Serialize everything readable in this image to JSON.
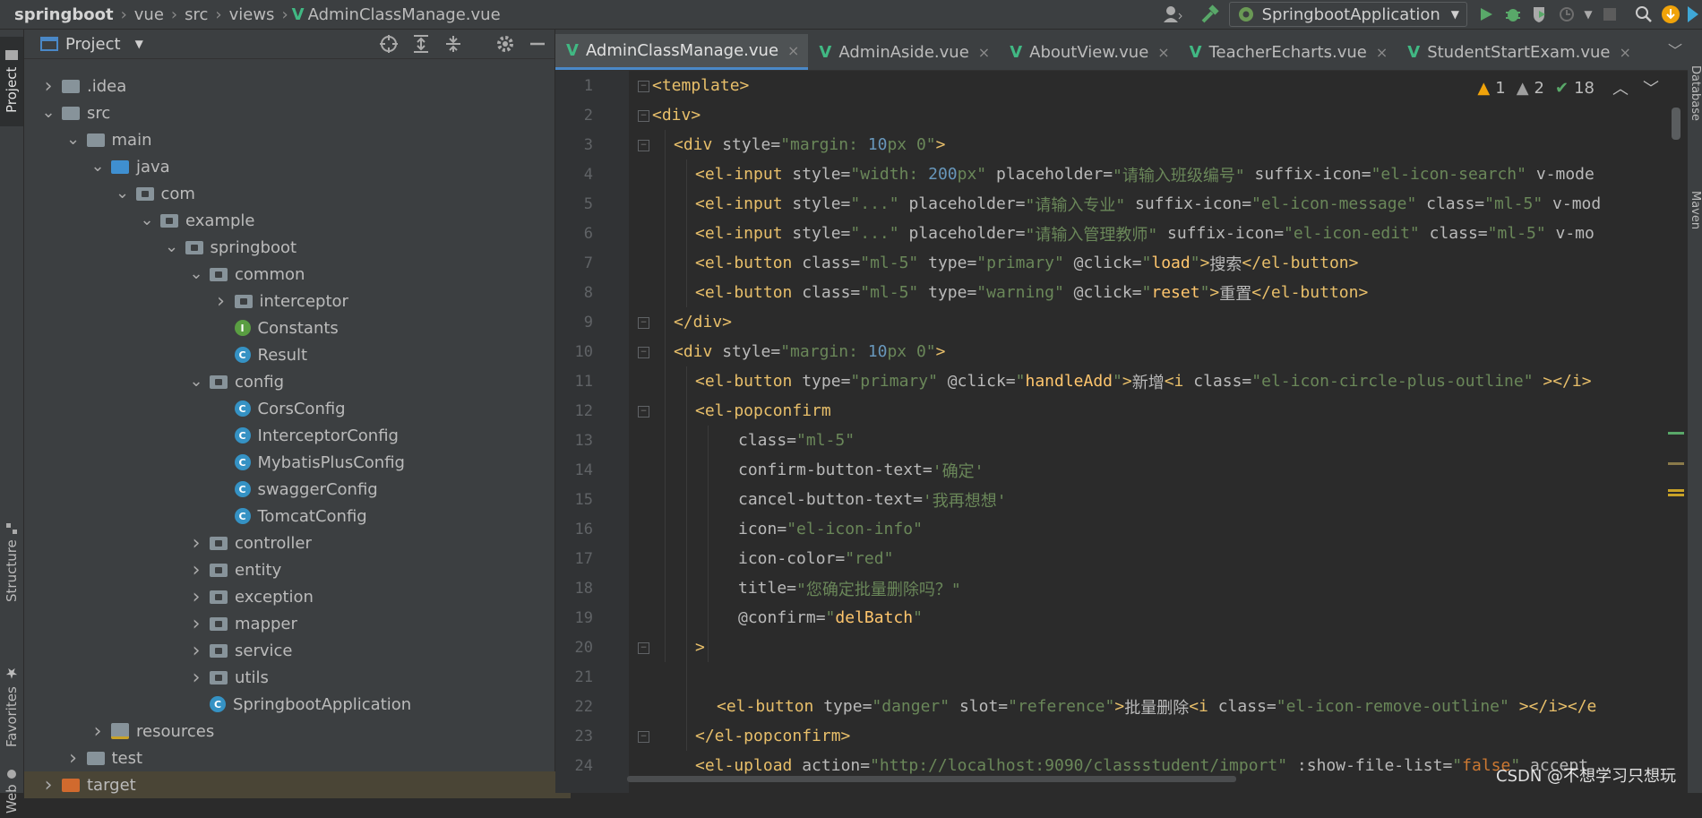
{
  "breadcrumb": [
    "springboot",
    "vue",
    "src",
    "views",
    "AdminClassManage.vue"
  ],
  "run_config": "SpringbootApplication",
  "side_tabs": {
    "project": "Project",
    "structure": "Structure",
    "favorites": "Favorites",
    "web": "Web"
  },
  "right_tabs": {
    "database": "Database",
    "maven": "Maven"
  },
  "project_panel": {
    "title": "Project"
  },
  "tree": [
    {
      "label": ".idea",
      "depth": 1,
      "chevron": "right",
      "icon": "folder"
    },
    {
      "label": "src",
      "depth": 1,
      "chevron": "down",
      "icon": "folder"
    },
    {
      "label": "main",
      "depth": 2,
      "chevron": "down",
      "icon": "folder"
    },
    {
      "label": "java",
      "depth": 3,
      "chevron": "down",
      "icon": "folder-source"
    },
    {
      "label": "com",
      "depth": 4,
      "chevron": "down",
      "icon": "package"
    },
    {
      "label": "example",
      "depth": 5,
      "chevron": "down",
      "icon": "package"
    },
    {
      "label": "springboot",
      "depth": 6,
      "chevron": "down",
      "icon": "package"
    },
    {
      "label": "common",
      "depth": 7,
      "chevron": "down",
      "icon": "package"
    },
    {
      "label": "interceptor",
      "depth": 8,
      "chevron": "right",
      "icon": "package"
    },
    {
      "label": "Constants",
      "depth": 8,
      "chevron": "",
      "icon": "interface"
    },
    {
      "label": "Result",
      "depth": 8,
      "chevron": "",
      "icon": "class"
    },
    {
      "label": "config",
      "depth": 7,
      "chevron": "down",
      "icon": "package"
    },
    {
      "label": "CorsConfig",
      "depth": 8,
      "chevron": "",
      "icon": "class"
    },
    {
      "label": "InterceptorConfig",
      "depth": 8,
      "chevron": "",
      "icon": "class"
    },
    {
      "label": "MybatisPlusConfig",
      "depth": 8,
      "chevron": "",
      "icon": "class"
    },
    {
      "label": "swaggerConfig",
      "depth": 8,
      "chevron": "",
      "icon": "class"
    },
    {
      "label": "TomcatConfig",
      "depth": 8,
      "chevron": "",
      "icon": "class"
    },
    {
      "label": "controller",
      "depth": 7,
      "chevron": "right",
      "icon": "package"
    },
    {
      "label": "entity",
      "depth": 7,
      "chevron": "right",
      "icon": "package"
    },
    {
      "label": "exception",
      "depth": 7,
      "chevron": "right",
      "icon": "package"
    },
    {
      "label": "mapper",
      "depth": 7,
      "chevron": "right",
      "icon": "package"
    },
    {
      "label": "service",
      "depth": 7,
      "chevron": "right",
      "icon": "package"
    },
    {
      "label": "utils",
      "depth": 7,
      "chevron": "right",
      "icon": "package"
    },
    {
      "label": "SpringbootApplication",
      "depth": 7,
      "chevron": "",
      "icon": "class"
    },
    {
      "label": "resources",
      "depth": 3,
      "chevron": "right",
      "icon": "folder-resources"
    },
    {
      "label": "test",
      "depth": 2,
      "chevron": "right",
      "icon": "folder"
    },
    {
      "label": "target",
      "depth": 1,
      "chevron": "right",
      "icon": "folder-excluded"
    }
  ],
  "editor_tabs": [
    "AdminClassManage.vue",
    "AdminAside.vue",
    "AboutView.vue",
    "TeacherEcharts.vue",
    "StudentStartExam.vue"
  ],
  "inspections": {
    "warnings": "1",
    "weak_warnings": "2",
    "ok": "18"
  },
  "code_lines": [
    {
      "n": "1",
      "indent": 0,
      "tokens": [
        [
          "tg",
          "<template>"
        ]
      ]
    },
    {
      "n": "2",
      "indent": 0,
      "tokens": [
        [
          "tg",
          "<div>"
        ]
      ]
    },
    {
      "n": "3",
      "indent": 1,
      "tokens": [
        [
          "tg",
          "<div "
        ],
        [
          "at",
          "style="
        ],
        [
          "sv",
          "\"margin: "
        ],
        [
          "nm",
          "10"
        ],
        [
          "sv",
          "px 0\""
        ],
        [
          "tg",
          ">"
        ]
      ]
    },
    {
      "n": "4",
      "indent": 2,
      "tokens": [
        [
          "tg",
          "<el-input "
        ],
        [
          "at",
          "style="
        ],
        [
          "sv",
          "\"width: "
        ],
        [
          "nm",
          "200"
        ],
        [
          "sv",
          "px\" "
        ],
        [
          "at",
          "placeholder="
        ],
        [
          "sv",
          "\"请输入班级编号\" "
        ],
        [
          "at",
          "suffix-icon="
        ],
        [
          "sv",
          "\"el-icon-search\" "
        ],
        [
          "at",
          "v-mode"
        ]
      ]
    },
    {
      "n": "5",
      "indent": 2,
      "tokens": [
        [
          "tg",
          "<el-input "
        ],
        [
          "at",
          "style="
        ],
        [
          "sv",
          "\"...\" "
        ],
        [
          "at",
          "placeholder="
        ],
        [
          "sv",
          "\"请输入专业\" "
        ],
        [
          "at",
          "suffix-icon="
        ],
        [
          "sv",
          "\"el-icon-message\" "
        ],
        [
          "at",
          "class="
        ],
        [
          "sv",
          "\"ml-5\" "
        ],
        [
          "at",
          "v-mod"
        ]
      ]
    },
    {
      "n": "6",
      "indent": 2,
      "tokens": [
        [
          "tg",
          "<el-input "
        ],
        [
          "at",
          "style="
        ],
        [
          "sv",
          "\"...\" "
        ],
        [
          "at",
          "placeholder="
        ],
        [
          "sv",
          "\"请输入管理教师\" "
        ],
        [
          "at",
          "suffix-icon="
        ],
        [
          "sv",
          "\"el-icon-edit\" "
        ],
        [
          "at",
          "class="
        ],
        [
          "sv",
          "\"ml-5\" "
        ],
        [
          "at",
          "v-mo"
        ]
      ]
    },
    {
      "n": "7",
      "indent": 2,
      "tokens": [
        [
          "tg",
          "<el-button "
        ],
        [
          "at",
          "class="
        ],
        [
          "sv",
          "\"ml-5\" "
        ],
        [
          "at",
          "type="
        ],
        [
          "sv",
          "\"primary\" "
        ],
        [
          "at",
          "@click="
        ],
        [
          "sv",
          "\""
        ],
        [
          "ev",
          "load"
        ],
        [
          "sv",
          "\""
        ],
        [
          "tg",
          ">"
        ],
        [
          "at",
          "搜索"
        ],
        [
          "tg",
          "</el-button>"
        ]
      ]
    },
    {
      "n": "8",
      "indent": 2,
      "tokens": [
        [
          "tg",
          "<el-button "
        ],
        [
          "at",
          "class="
        ],
        [
          "sv",
          "\"ml-5\" "
        ],
        [
          "at",
          "type="
        ],
        [
          "sv",
          "\"warning\" "
        ],
        [
          "at",
          "@click="
        ],
        [
          "sv",
          "\""
        ],
        [
          "ev",
          "reset"
        ],
        [
          "sv",
          "\""
        ],
        [
          "tg",
          ">"
        ],
        [
          "at",
          "重置"
        ],
        [
          "tg",
          "</el-button>"
        ]
      ]
    },
    {
      "n": "9",
      "indent": 1,
      "tokens": [
        [
          "tg",
          "</div>"
        ]
      ]
    },
    {
      "n": "10",
      "indent": 1,
      "tokens": [
        [
          "tg",
          "<div "
        ],
        [
          "at",
          "style="
        ],
        [
          "sv",
          "\"margin: "
        ],
        [
          "nm",
          "10"
        ],
        [
          "sv",
          "px 0\""
        ],
        [
          "tg",
          ">"
        ]
      ]
    },
    {
      "n": "11",
      "indent": 2,
      "tokens": [
        [
          "tg",
          "<el-button "
        ],
        [
          "at",
          "type="
        ],
        [
          "sv",
          "\"primary\" "
        ],
        [
          "at",
          "@click="
        ],
        [
          "sv",
          "\""
        ],
        [
          "ev",
          "handleAdd"
        ],
        [
          "sv",
          "\""
        ],
        [
          "tg",
          ">"
        ],
        [
          "at",
          "新增"
        ],
        [
          "tg",
          "<i "
        ],
        [
          "at",
          "class="
        ],
        [
          "sv",
          "\"el-icon-circle-plus-outline\" "
        ],
        [
          "tg",
          "></i>"
        ]
      ]
    },
    {
      "n": "12",
      "indent": 2,
      "tokens": [
        [
          "tg",
          "<el-popconfirm"
        ]
      ]
    },
    {
      "n": "13",
      "indent": 4,
      "tokens": [
        [
          "at",
          "class="
        ],
        [
          "sv",
          "\"ml-5\""
        ]
      ]
    },
    {
      "n": "14",
      "indent": 4,
      "tokens": [
        [
          "at",
          "confirm-button-text="
        ],
        [
          "sv",
          "'确定'"
        ]
      ]
    },
    {
      "n": "15",
      "indent": 4,
      "tokens": [
        [
          "at",
          "cancel-button-text="
        ],
        [
          "sv",
          "'我再想想'"
        ]
      ]
    },
    {
      "n": "16",
      "indent": 4,
      "tokens": [
        [
          "at",
          "icon="
        ],
        [
          "sv",
          "\"el-icon-info\""
        ]
      ]
    },
    {
      "n": "17",
      "indent": 4,
      "tokens": [
        [
          "at",
          "icon-color="
        ],
        [
          "sv",
          "\"red\""
        ]
      ]
    },
    {
      "n": "18",
      "indent": 4,
      "tokens": [
        [
          "at",
          "title="
        ],
        [
          "sv",
          "\"您确定批量删除吗？\""
        ]
      ]
    },
    {
      "n": "19",
      "indent": 4,
      "tokens": [
        [
          "at",
          "@confirm="
        ],
        [
          "sv",
          "\""
        ],
        [
          "ev",
          "delBatch"
        ],
        [
          "sv",
          "\""
        ]
      ]
    },
    {
      "n": "20",
      "indent": 2,
      "tokens": [
        [
          "tg",
          ">"
        ]
      ]
    },
    {
      "n": "21",
      "indent": 0,
      "tokens": []
    },
    {
      "n": "22",
      "indent": 3,
      "tokens": [
        [
          "tg",
          "<el-button "
        ],
        [
          "at",
          "type="
        ],
        [
          "sv",
          "\"danger\" "
        ],
        [
          "at",
          "slot="
        ],
        [
          "sv",
          "\"reference\""
        ],
        [
          "tg",
          ">"
        ],
        [
          "at",
          "批量删除"
        ],
        [
          "tg",
          "<i "
        ],
        [
          "at",
          "class="
        ],
        [
          "sv",
          "\"el-icon-remove-outline\" "
        ],
        [
          "tg",
          "></i></e"
        ]
      ]
    },
    {
      "n": "23",
      "indent": 2,
      "tokens": [
        [
          "tg",
          "</el-popconfirm>"
        ]
      ]
    },
    {
      "n": "24",
      "indent": 2,
      "tokens": [
        [
          "tg",
          "<el-upload "
        ],
        [
          "at",
          "action="
        ],
        [
          "sv",
          "\"http://localhost:9090/classstudent/import\" "
        ],
        [
          "at",
          ":show-file-list="
        ],
        [
          "sv",
          "\""
        ],
        [
          "kw",
          "false"
        ],
        [
          "sv",
          "\" "
        ],
        [
          "at",
          "accept"
        ]
      ]
    }
  ],
  "watermark": "CSDN @不想学习只想玩"
}
